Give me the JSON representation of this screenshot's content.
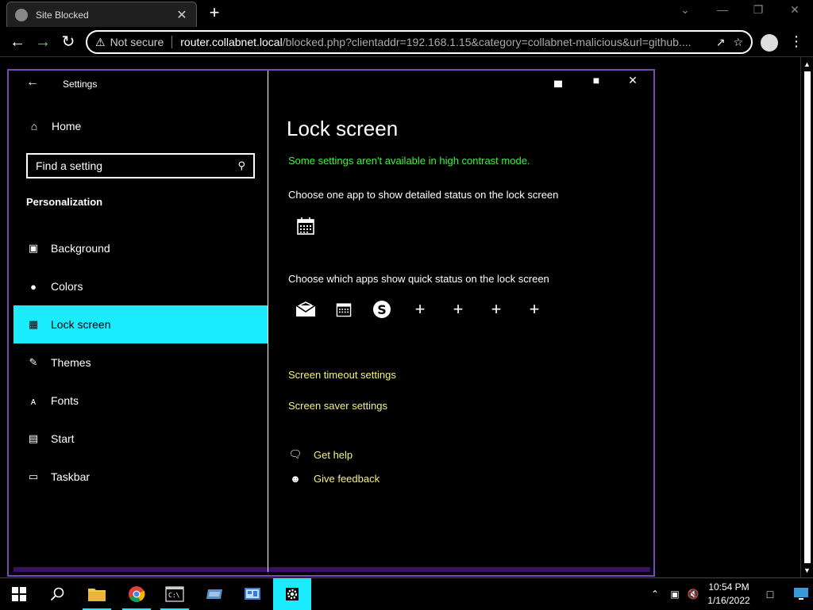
{
  "browser": {
    "tab_title": "Site Blocked",
    "tab_close": "✕",
    "new_tab": "+",
    "security_label": "Not secure",
    "url_host": "router.collabnet.local",
    "url_path": "/blocked.php?clientaddr=192.168.1.15&category=collabnet-malicious&url=github...."
  },
  "settings": {
    "app_title": "Settings",
    "home_label": "Home",
    "search_placeholder": "Find a setting",
    "section_title": "Personalization",
    "nav_items": [
      {
        "label": "Background"
      },
      {
        "label": "Colors"
      },
      {
        "label": "Lock screen"
      },
      {
        "label": "Themes"
      },
      {
        "label": "Fonts"
      },
      {
        "label": "Start"
      },
      {
        "label": "Taskbar"
      }
    ],
    "active_item": "Lock screen",
    "page_title": "Lock screen",
    "contrast_note": "Some settings aren't available in high contrast mode.",
    "detailed_label": "Choose one app to show detailed status on the lock screen",
    "quick_label": "Choose which apps show quick status on the lock screen",
    "quick_apps": [
      "mail-icon",
      "calendar-icon",
      "skype-icon",
      "add-icon",
      "add-icon",
      "add-icon",
      "add-icon"
    ],
    "links": {
      "timeout": "Screen timeout settings",
      "saver": "Screen saver settings"
    },
    "help": {
      "get_help": "Get help",
      "feedback": "Give feedback"
    }
  },
  "taskbar": {
    "time": "10:54 PM",
    "date": "1/16/2022"
  },
  "colors": {
    "accent": "#1aebff",
    "note_green": "#3ff23f",
    "link_yellow": "#f4f47a",
    "window_border": "#7a49b8"
  }
}
